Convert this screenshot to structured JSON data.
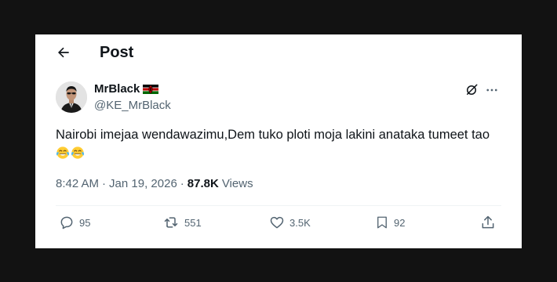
{
  "header": {
    "title": "Post",
    "back_icon": "arrow-left-icon"
  },
  "author": {
    "display_name": "MrBlack",
    "flag": "kenya-flag",
    "handle": "@KE_MrBlack",
    "avatar": "avatar"
  },
  "post": {
    "text": "Nairobi imejaa wendawazimu,Dem tuko ploti moja lakini anataka tumeet tao",
    "emojis": [
      "face-with-tears-of-joy",
      "face-with-tears-of-joy"
    ]
  },
  "meta": {
    "time": "8:42 AM",
    "separator": "·",
    "date": "Jan 19, 2026",
    "views_count": "87.8K",
    "views_label": "Views"
  },
  "actions": {
    "replies": "95",
    "reposts": "551",
    "likes": "3.5K",
    "bookmarks": "92"
  },
  "colors": {
    "text_primary": "#0f1419",
    "text_secondary": "#536471",
    "divider": "#eff3f4",
    "background": "#121212"
  }
}
